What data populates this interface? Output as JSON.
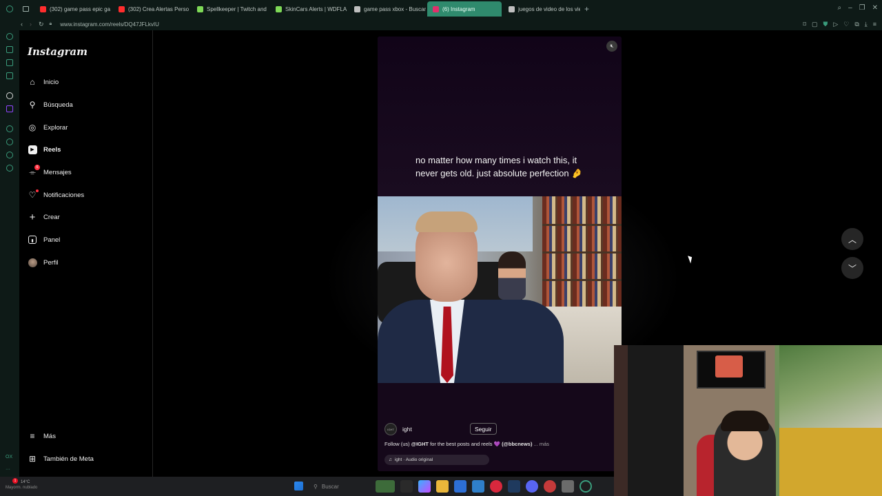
{
  "browser": {
    "tabs": [
      {
        "label": "(302) game pass epic ga",
        "color": "#ff2d2d"
      },
      {
        "label": "(302) Crea Alertas Perso",
        "color": "#ff2d2d"
      },
      {
        "label": "Spellkeeper | Twitch and",
        "color": "#7ed957"
      },
      {
        "label": "SkinCars Alerts | WDFLA",
        "color": "#7ed957"
      },
      {
        "label": "game pass xbox - Buscar",
        "color": "#bfbfbf"
      },
      {
        "label": "(6) Instagram",
        "color": "#e1306c",
        "active": true
      },
      {
        "label": "juegos de video de los vie",
        "color": "#bfbfbf"
      }
    ],
    "url": "www.instagram.com/reels/DQ47JFLkvIU"
  },
  "instagram": {
    "logo": "Instagram",
    "nav": [
      {
        "label": "Inicio",
        "icon": "home-icon"
      },
      {
        "label": "Búsqueda",
        "icon": "search-icon"
      },
      {
        "label": "Explorar",
        "icon": "compass-icon"
      },
      {
        "label": "Reels",
        "icon": "reels-icon"
      },
      {
        "label": "Mensajes",
        "icon": "messenger-icon",
        "badge": "6"
      },
      {
        "label": "Notificaciones",
        "icon": "heart-icon"
      },
      {
        "label": "Crear",
        "icon": "plus-icon"
      },
      {
        "label": "Panel",
        "icon": "chart-icon"
      },
      {
        "label": "Perfil",
        "icon": "avatar"
      }
    ],
    "more": "Más",
    "meta": "También de Meta"
  },
  "reel": {
    "caption": "no matter how many times i watch this, it never gets old. just absolute perfection 🤌",
    "account": "ight",
    "account_avatar": "IGHT",
    "separator": "·",
    "follow": "Seguir",
    "desc_prefix": "Follow (us) ",
    "desc_handle": "@IGHT",
    "desc_mid": " for the best posts and reels 💜 ",
    "desc_handle2": "(@bbcnews)",
    "desc_more": " ... más",
    "audio": "ight · Audio original"
  },
  "taskbar": {
    "temp": "14°C",
    "weather": "Mayorm. nublado",
    "weather_badge": "1",
    "search": "Buscar"
  }
}
